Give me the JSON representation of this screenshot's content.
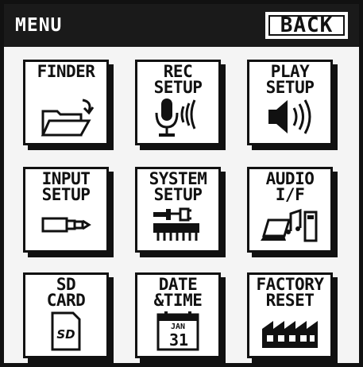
{
  "header": {
    "title": "MENU",
    "back_label": "BACK"
  },
  "tiles": [
    {
      "label": "FINDER",
      "icon": "folder-icon"
    },
    {
      "label": "REC\nSETUP",
      "icon": "microphone-icon"
    },
    {
      "label": "PLAY\nSETUP",
      "icon": "speaker-icon"
    },
    {
      "label": "INPUT\nSETUP",
      "icon": "audio-jack-icon"
    },
    {
      "label": "SYSTEM\nSETUP",
      "icon": "chip-icon"
    },
    {
      "label": "AUDIO\nI/F",
      "icon": "laptop-audio-icon"
    },
    {
      "label": "SD\nCARD",
      "icon": "sd-card-icon"
    },
    {
      "label": "DATE\n&TIME",
      "icon": "calendar-icon",
      "calendar_month": "JAN",
      "calendar_day": "31"
    },
    {
      "label": "FACTORY\nRESET",
      "icon": "factory-icon"
    }
  ],
  "colors": {
    "ink": "#111111",
    "background": "#f4f4f4",
    "tile": "#ffffff"
  }
}
